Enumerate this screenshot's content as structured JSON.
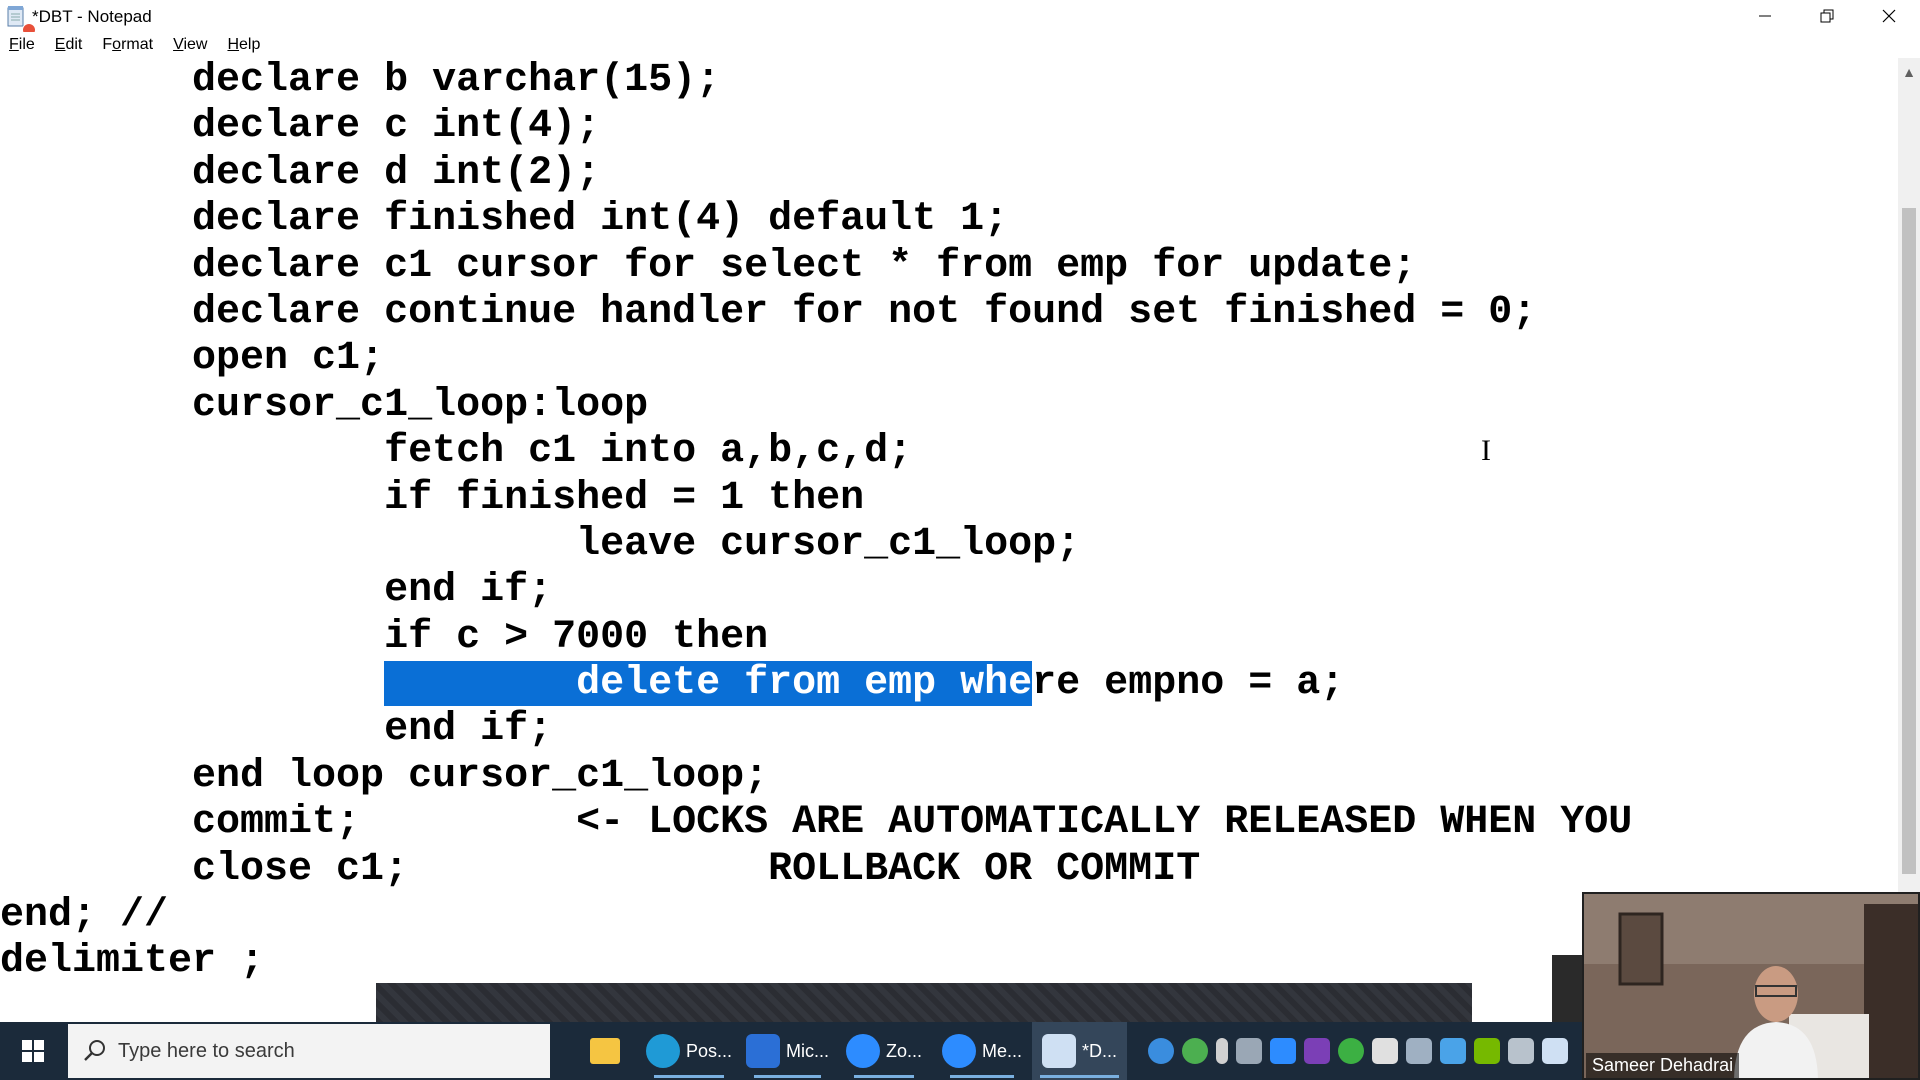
{
  "window": {
    "title": "*DBT - Notepad"
  },
  "menu": {
    "items": [
      {
        "label": "File",
        "accel": "F",
        "rest": "ile"
      },
      {
        "label": "Edit",
        "accel": "E",
        "rest": "dit"
      },
      {
        "label": "Format",
        "accel": "o",
        "pre": "F",
        "rest": "rmat"
      },
      {
        "label": "View",
        "accel": "V",
        "rest": "iew"
      },
      {
        "label": "Help",
        "accel": "H",
        "rest": "elp"
      }
    ]
  },
  "editor": {
    "lines": [
      "        declare b varchar(15);",
      "        declare c int(4);",
      "        declare d int(2);",
      "        declare finished int(4) default 1;",
      "        declare c1 cursor for select * from emp for update;",
      "        declare continue handler for not found set finished = 0;",
      "        open c1;",
      "        cursor_c1_loop:loop",
      "                fetch c1 into a,b,c,d;",
      "                if finished = 1 then",
      "                        leave cursor_c1_loop;",
      "                end if;",
      "                if c > 7000 then",
      "SELECTED",
      "                end if;",
      "        end loop cursor_c1_loop;",
      "        commit;         <- LOCKS ARE AUTOMATICALLY RELEASED WHEN YOU",
      "        close c1;               ROLLBACK OR COMMIT",
      "end; //",
      "delimiter ;"
    ],
    "selected_line": {
      "before": "                ",
      "selected": "        delete from emp whe",
      "after": "re empno = a;"
    }
  },
  "taskbar": {
    "search_placeholder": "Type here to search",
    "apps": [
      {
        "label": "",
        "icon": "file-explorer-icon"
      },
      {
        "label": "Pos...",
        "icon": "edge-icon"
      },
      {
        "label": "Mic...",
        "icon": "whiteboard-icon"
      },
      {
        "label": "Zo...",
        "icon": "zoom-icon"
      },
      {
        "label": "Me...",
        "icon": "zoom-meeting-icon"
      },
      {
        "label": "*D...",
        "icon": "notepad-icon"
      }
    ]
  },
  "webcam": {
    "participant_name": "Sameer Dehadrai"
  },
  "colors": {
    "selection": "#0a6fd6",
    "taskbar": "#1b2a3a"
  }
}
